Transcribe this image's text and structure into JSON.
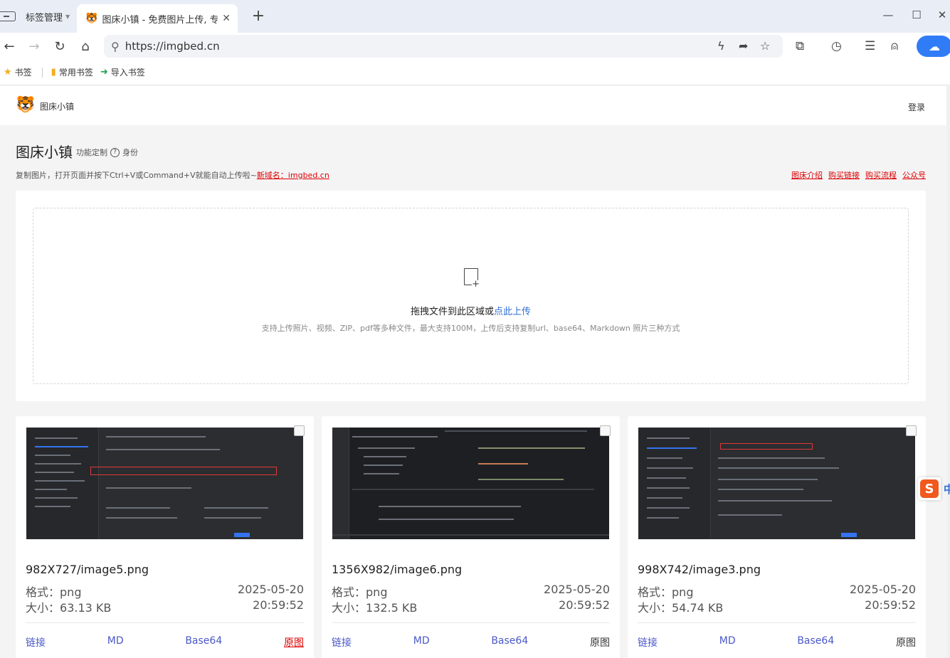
{
  "browser": {
    "tab_manager_label": "标签管理",
    "active_tab_title": "图床小镇 - 免费图片上传, 专业",
    "url": "https://imgbed.cn",
    "bookmarks": [
      {
        "label": "书签",
        "icon": "star-icon"
      },
      {
        "label": "常用书签",
        "icon": "bookmark-icon"
      },
      {
        "label": "导入书签",
        "icon": "import-icon"
      }
    ]
  },
  "site": {
    "name": "图床小镇",
    "login": "登录",
    "hero_title": "图床小镇",
    "hero_customize": "功能定制",
    "hero_identity": "身份",
    "hint_text": "复制图片，打开页面并按下Ctrl+V或Command+V就能自动上传啦~",
    "hint_link": "新域名：imgbed.cn",
    "top_links": [
      "图床介绍",
      "购买链接",
      "购买流程",
      "公众号"
    ]
  },
  "upload": {
    "drop_text": "拖拽文件到此区域或",
    "drop_link": "点此上传",
    "drop_sub": "支持上传照片、视频、ZIP、pdf等多种文件，最大支持100M，上传后支持复制url、base64、Markdown 照片三种方式"
  },
  "labels": {
    "format_prefix": "格式：",
    "size_prefix": "大小：",
    "action_link": "链接",
    "action_md": "MD",
    "action_base64": "Base64",
    "action_original": "原图"
  },
  "cards": [
    {
      "file": "982X727/image5.png",
      "format": "png",
      "size": "63.13 KB",
      "date": "2025-05-20",
      "time": "20:59:52"
    },
    {
      "file": "1356X982/image6.png",
      "format": "png",
      "size": "132.5 KB",
      "date": "2025-05-20",
      "time": "20:59:52"
    },
    {
      "file": "998X742/image3.png",
      "format": "png",
      "size": "54.74 KB",
      "date": "2025-05-20",
      "time": "20:59:52"
    }
  ],
  "ime": {
    "label": "中"
  },
  "colors": {
    "accent_blue": "#2f6fd8",
    "link_red": "#dd0000",
    "action_purple": "#4a58c7"
  }
}
